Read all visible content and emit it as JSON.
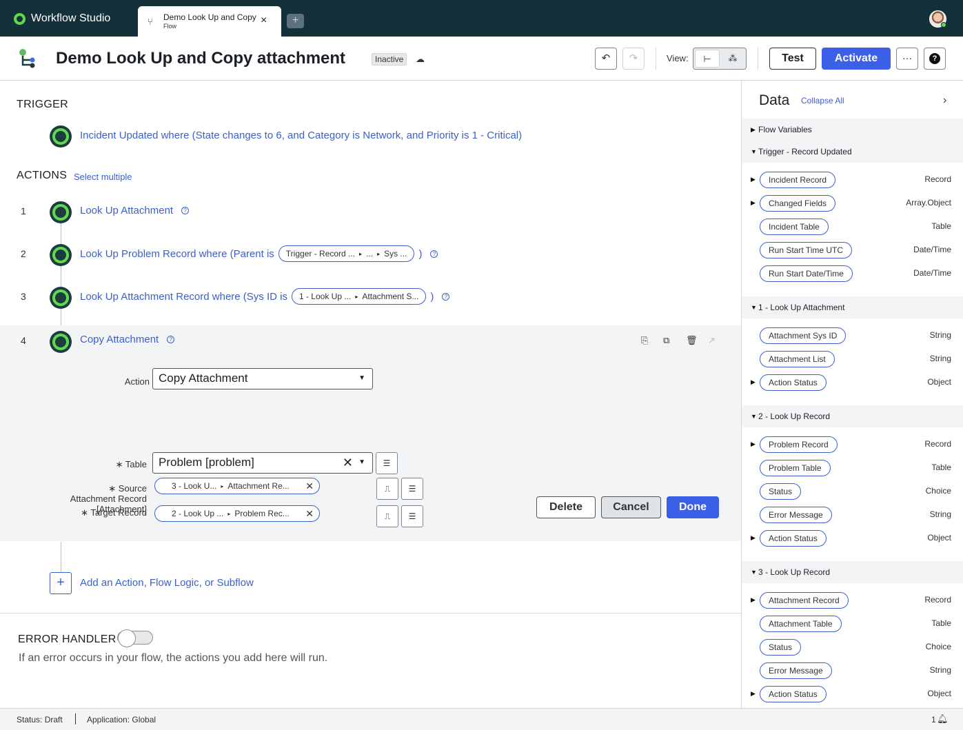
{
  "app": {
    "name": "Workflow Studio"
  },
  "tab": {
    "title": "Demo Look Up and Copy attachment",
    "subtitle": "Flow",
    "close": "×",
    "add": "+"
  },
  "header": {
    "title": "Demo Look Up and Copy attachment",
    "status_badge": "Inactive",
    "view_label": "View:",
    "test_label": "Test",
    "activate_label": "Activate",
    "more_label": "···",
    "help_label": "?"
  },
  "trigger": {
    "heading": "TRIGGER",
    "text": "Incident Updated where (State changes to 6, and Category is Network, and Priority is 1 - Critical)"
  },
  "actions": {
    "heading": "ACTIONS",
    "select_multiple": "Select multiple",
    "steps": [
      {
        "num": "1",
        "text": "Look Up Attachment"
      },
      {
        "num": "2",
        "text": "Look Up Problem Record where (Parent is",
        "pill": [
          "Trigger - Record ...",
          "...",
          "Sys ..."
        ],
        "close": ")"
      },
      {
        "num": "3",
        "text": "Look Up Attachment Record where (Sys ID is",
        "pill": [
          "1 - Look Up ...",
          "Attachment S..."
        ],
        "close": ")"
      },
      {
        "num": "4",
        "text": "Copy Attachment"
      }
    ]
  },
  "form": {
    "action_label": "Action",
    "action_value": "Copy Attachment",
    "source_label": "∗ Source Attachment Record [Attachment]",
    "source_pill": [
      "3 - Look U...",
      "Attachment Re..."
    ],
    "target_label": "∗ Target Record",
    "target_pill": [
      "2 - Look Up ...",
      "Problem Rec..."
    ],
    "table_label": "∗ Table",
    "table_value": "Problem [problem]",
    "delete_label": "Delete",
    "cancel_label": "Cancel",
    "done_label": "Done"
  },
  "add_action": {
    "text": "Add an Action, Flow Logic, or Subflow",
    "plus": "+"
  },
  "error_handler": {
    "heading": "ERROR HANDLER",
    "enabled": false,
    "description": "If an error occurs in your flow, the actions you add here will run."
  },
  "data_panel": {
    "title": "Data",
    "collapse_all": "Collapse All",
    "groups": [
      {
        "label": "Flow Variables",
        "expanded": false
      },
      {
        "label": "Trigger - Record Updated",
        "expanded": true,
        "items": [
          {
            "label": "Incident Record",
            "type": "Record",
            "expandable": true
          },
          {
            "label": "Changed Fields",
            "type": "Array.Object",
            "expandable": true
          },
          {
            "label": "Incident Table",
            "type": "Table",
            "expandable": false
          },
          {
            "label": "Run Start Time UTC",
            "type": "Date/Time",
            "expandable": false
          },
          {
            "label": "Run Start Date/Time",
            "type": "Date/Time",
            "expandable": false
          }
        ]
      },
      {
        "label": "1 - Look Up Attachment",
        "expanded": true,
        "items": [
          {
            "label": "Attachment Sys ID",
            "type": "String",
            "expandable": false
          },
          {
            "label": "Attachment List",
            "type": "String",
            "expandable": false
          },
          {
            "label": "Action Status",
            "type": "Object",
            "expandable": true
          }
        ]
      },
      {
        "label": "2 - Look Up Record",
        "expanded": true,
        "items": [
          {
            "label": "Problem Record",
            "type": "Record",
            "expandable": true
          },
          {
            "label": "Problem Table",
            "type": "Table",
            "expandable": false
          },
          {
            "label": "Status",
            "type": "Choice",
            "expandable": false
          },
          {
            "label": "Error Message",
            "type": "String",
            "expandable": false
          },
          {
            "label": "Action Status",
            "type": "Object",
            "expandable": true
          }
        ]
      },
      {
        "label": "3 - Look Up Record",
        "expanded": true,
        "items": [
          {
            "label": "Attachment Record",
            "type": "Record",
            "expandable": true
          },
          {
            "label": "Attachment Table",
            "type": "Table",
            "expandable": false
          },
          {
            "label": "Status",
            "type": "Choice",
            "expandable": false
          },
          {
            "label": "Error Message",
            "type": "String",
            "expandable": false
          },
          {
            "label": "Action Status",
            "type": "Object",
            "expandable": true
          }
        ]
      }
    ]
  },
  "statusbar": {
    "status": "Status: Draft",
    "application": "Application: Global",
    "notifications": "1"
  },
  "colors": {
    "topbar": "#143039",
    "accent": "#3c5fe8",
    "link": "#3c5fc9",
    "node_ring": "#62d84e"
  }
}
